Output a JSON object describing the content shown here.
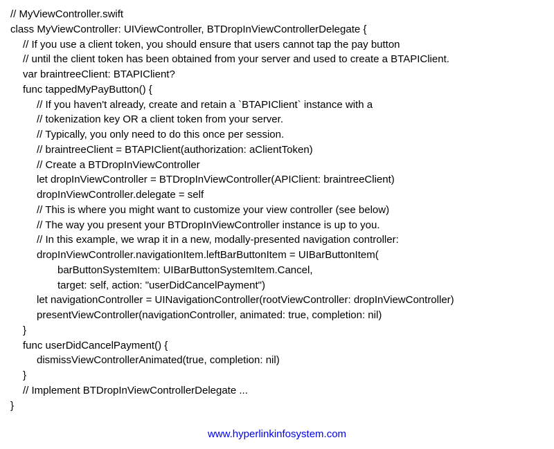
{
  "code": {
    "l01": "// MyViewController.swift",
    "l02": "class MyViewController: UIViewController, BTDropInViewControllerDelegate {",
    "l03": "// If you use a client token, you should ensure that users cannot tap the pay button",
    "l04": "// until the client token has been obtained from your server and used to create a BTAPIClient.",
    "l05": "var braintreeClient: BTAPIClient?",
    "l06": "func tappedMyPayButton() {",
    "l07": "// If you haven't already, create and retain a `BTAPIClient` instance with a",
    "l08": "// tokenization key OR a client token from your server.",
    "l09": "// Typically, you only need to do this once per session.",
    "l10": "// braintreeClient = BTAPIClient(authorization: aClientToken)",
    "l11": "// Create a BTDropInViewController",
    "l12": "let dropInViewController = BTDropInViewController(APIClient: braintreeClient)",
    "l13": "dropInViewController.delegate = self",
    "l14": "// This is where you might want to customize your view controller (see below)",
    "l15": "// The way you present your BTDropInViewController instance is up to you.",
    "l16": "// In this example, we wrap it in a new, modally-presented navigation controller:",
    "l17": "dropInViewController.navigationItem.leftBarButtonItem = UIBarButtonItem(",
    "l18": "barButtonSystemItem: UIBarButtonSystemItem.Cancel,",
    "l19": "target: self, action: \"userDidCancelPayment\")",
    "l20": "let navigationController = UINavigationController(rootViewController: dropInViewController)",
    "l21": "presentViewController(navigationController, animated: true, completion: nil)",
    "l22": "}",
    "l23": "func userDidCancelPayment() {",
    "l24": "dismissViewControllerAnimated(true, completion: nil)",
    "l25": "}",
    "l26": "// Implement BTDropInViewControllerDelegate ...",
    "l27": "}"
  },
  "link": {
    "text": "www.hyperlinkinfosystem.com"
  }
}
